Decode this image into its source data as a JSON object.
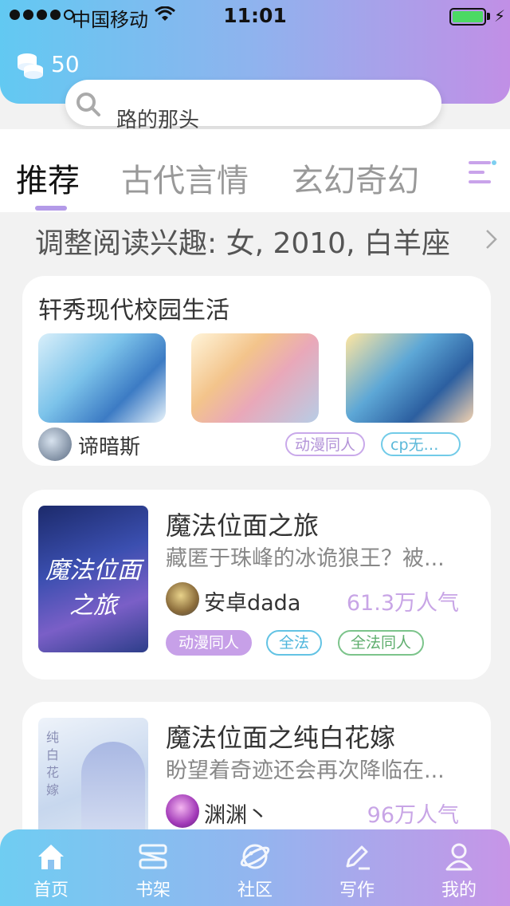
{
  "status_bar": {
    "carrier": "中国移动",
    "time": "11:01"
  },
  "header": {
    "coin_count": "50"
  },
  "search": {
    "placeholder": "路的那头"
  },
  "tabs": [
    {
      "label": "推荐"
    },
    {
      "label": "古代言情"
    },
    {
      "label": "玄幻奇幻"
    }
  ],
  "interest": {
    "text": "调整阅读兴趣: 女, 2010, 白羊座"
  },
  "collection": {
    "title": "轩秀现代校园生活",
    "author": "谛暗斯",
    "tags": [
      "动漫同人",
      "cp无虐..."
    ]
  },
  "books": [
    {
      "title": "魔法位面之旅",
      "cover_text": "魔法位面之旅",
      "description": "藏匿于珠峰的冰诡狼王？被...",
      "author": "安卓dada",
      "popularity": "61.3万人气",
      "tags": [
        "动漫同人",
        "全法",
        "全法同人"
      ]
    },
    {
      "title": "魔法位面之纯白花嫁",
      "cover_text": "纯白花嫁",
      "description": "盼望着奇迹还会再次降临在...",
      "author": "渊渊丶",
      "popularity": "96万人气"
    }
  ],
  "tabbar": {
    "items": [
      {
        "label": "首页",
        "icon": "home-icon"
      },
      {
        "label": "书架",
        "icon": "bookshelf-icon"
      },
      {
        "label": "社区",
        "icon": "community-icon"
      },
      {
        "label": "写作",
        "icon": "write-icon"
      },
      {
        "label": "我的",
        "icon": "profile-icon"
      }
    ]
  },
  "colors": {
    "accent": "#b39ae8",
    "popularity": "#c8a5e6",
    "header_start": "#62c9f2",
    "header_end": "#c18fe6"
  }
}
